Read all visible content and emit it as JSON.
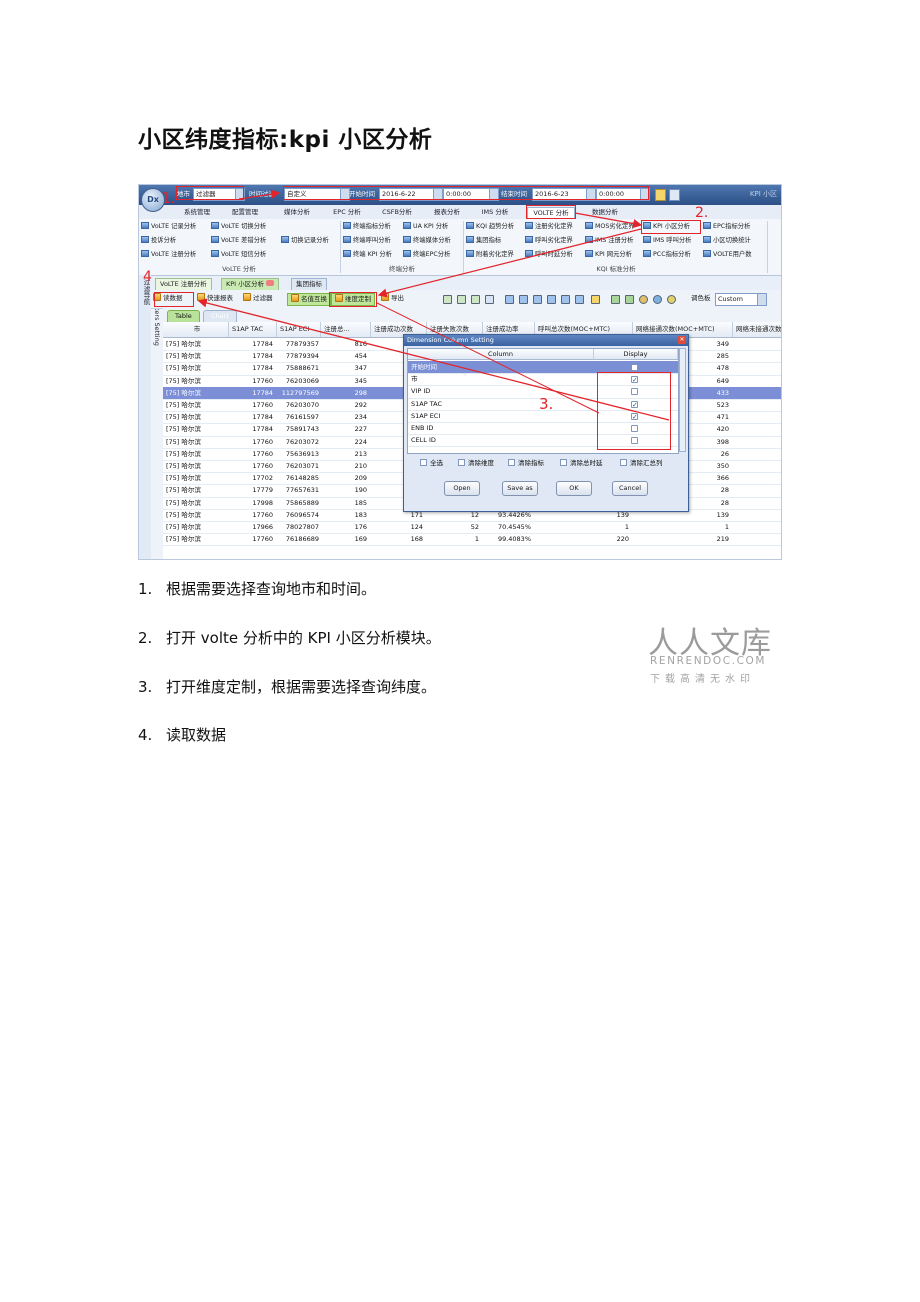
{
  "document": {
    "title": "小区纬度指标:kpi 小区分析",
    "steps": [
      {
        "num": "1.",
        "text": "根据需要选择查询地市和时间。"
      },
      {
        "num": "2.",
        "text": "打开 volte 分析中的 KPI 小区分析模块。"
      },
      {
        "num": "3.",
        "text": "打开维度定制，根据需要选择查询纬度。"
      },
      {
        "num": "4.",
        "text": "读取数据"
      }
    ]
  },
  "screenshot": {
    "logo": "Dx",
    "topbar": {
      "city_label": "地市",
      "city_value": "过滤器",
      "time_filter_label": "时间过滤",
      "time_filter_value": "自定义",
      "start_label": "开始时间",
      "start_date": "2016-6-22",
      "start_time": "0:00:00",
      "end_label": "结束时间",
      "end_date": "2016-6-23",
      "end_time": "0:00:00",
      "app_title": "KPI 小区"
    },
    "menu_tabs": [
      "系统管理",
      "配置管理",
      "媒体分析",
      "EPC 分析",
      "CSFB分析",
      "报表分析",
      "IMS 分析",
      "VOLTE 分析",
      "数据分析"
    ],
    "ribbon": {
      "col1": [
        "VoLTE 记录分析",
        "投诉分析",
        "VoLTE 注册分析"
      ],
      "col2": [
        "VoLTE 切换分析",
        "VoLTE 差错分析",
        "VoLTE 短信分析"
      ],
      "col3": [
        "切换记录分析"
      ],
      "col4": [
        "终端指标分析",
        "终端呼叫分析",
        "终端 KPI 分析"
      ],
      "col5": [
        "UA KPI 分析",
        "终端媒体分析",
        "终端EPC分析"
      ],
      "col6": [
        "KQI 趋势分析",
        "集团指标",
        "附着劣化定界"
      ],
      "col7": [
        "注册劣化定界",
        "呼叫劣化定界",
        "呼叫时延分析"
      ],
      "col8": [
        "MOS劣化定界",
        "IMS 注册分析",
        "KPI 网元分析"
      ],
      "col9": [
        "KPI 小区分析",
        "IMS 呼叫分析",
        "PCC指标分析"
      ],
      "col10": [
        "EPC指标分析",
        "小区切换统计",
        "VOLTE用户数"
      ],
      "groups": [
        "VoLTE 分析",
        "终端分析",
        "KQI 标准分析"
      ]
    },
    "left_strip": "过滤导航",
    "filters_strip": "Filters Setting",
    "subtabs": [
      "VoLTE 注册分析",
      "KPI 小区分析",
      "集团指标"
    ],
    "toolbar": {
      "read_data": "读数据",
      "quick_report": "快速报表",
      "filter": "过滤器",
      "name_swap": "名值互换",
      "dimension": "维度定制",
      "export": "导出",
      "palette_label": "调色板",
      "palette_value": "Custom"
    },
    "view_tabs": [
      "Table",
      "Chart"
    ],
    "grid": {
      "headers": [
        "市",
        "S1AP TAC",
        "S1AP ECI",
        "注册总...",
        "注册成功次数",
        "注册失败次数",
        "注册成功率",
        "呼叫总次数(MOC+MTC)",
        "网络接通次数(MOC+MTC)",
        "网络未接通次数"
      ],
      "rows": [
        [
          "[75] 哈尔滨",
          "17784",
          "77879357",
          "816",
          "",
          "",
          "",
          "",
          "349"
        ],
        [
          "[75] 哈尔滨",
          "17784",
          "77879394",
          "454",
          "",
          "",
          "",
          "",
          "285"
        ],
        [
          "[75] 哈尔滨",
          "17784",
          "75888671",
          "347",
          "",
          "",
          "",
          "",
          "478"
        ],
        [
          "[75] 哈尔滨",
          "17760",
          "76203069",
          "345",
          "",
          "",
          "",
          "",
          "649"
        ],
        [
          "[75] 哈尔滨",
          "17784",
          "112797569",
          "298",
          "",
          "",
          "",
          "",
          "433"
        ],
        [
          "[75] 哈尔滨",
          "17760",
          "76203070",
          "292",
          "",
          "",
          "",
          "",
          "523"
        ],
        [
          "[75] 哈尔滨",
          "17784",
          "76161597",
          "234",
          "",
          "",
          "",
          "",
          "471"
        ],
        [
          "[75] 哈尔滨",
          "17784",
          "75891743",
          "227",
          "",
          "",
          "",
          "",
          "420"
        ],
        [
          "[75] 哈尔滨",
          "17760",
          "76203072",
          "224",
          "",
          "",
          "",
          "",
          "398"
        ],
        [
          "[75] 哈尔滨",
          "17760",
          "75636913",
          "213",
          "",
          "",
          "",
          "",
          "26"
        ],
        [
          "[75] 哈尔滨",
          "17760",
          "76203071",
          "210",
          "",
          "",
          "",
          "",
          "350"
        ],
        [
          "[75] 哈尔滨",
          "17702",
          "76148285",
          "209",
          "",
          "",
          "",
          "",
          "366"
        ],
        [
          "[75] 哈尔滨",
          "17779",
          "77657631",
          "190",
          "",
          "",
          "",
          "",
          "28"
        ],
        [
          "[75] 哈尔滨",
          "17998",
          "75865889",
          "185",
          "184",
          "1",
          "99.4595%",
          "28",
          "28"
        ],
        [
          "[75] 哈尔滨",
          "17760",
          "76096574",
          "183",
          "171",
          "12",
          "93.4426%",
          "139",
          "139"
        ],
        [
          "[75] 哈尔滨",
          "17966",
          "78027807",
          "176",
          "124",
          "52",
          "70.4545%",
          "1",
          "1"
        ],
        [
          "[75] 哈尔滨",
          "17760",
          "76186689",
          "169",
          "168",
          "1",
          "99.4083%",
          "220",
          "219"
        ]
      ]
    },
    "dialog": {
      "title": "Dimension Column Setting",
      "col_header": "Column",
      "display_header": "Display",
      "rows": [
        {
          "name": "开始时间",
          "checked": false
        },
        {
          "name": "市",
          "checked": true
        },
        {
          "name": "VIP ID",
          "checked": false
        },
        {
          "name": "S1AP TAC",
          "checked": true
        },
        {
          "name": "S1AP ECI",
          "checked": true
        },
        {
          "name": "ENB ID",
          "checked": false
        },
        {
          "name": "CELL ID",
          "checked": false
        }
      ],
      "options": [
        "全选",
        "清除维度",
        "清除指标",
        "清除总时延",
        "清除汇总列"
      ],
      "buttons": [
        "Open",
        "Save as",
        "OK",
        "Cancel"
      ]
    },
    "annotations": [
      "1.",
      "2.",
      "3.",
      "4"
    ]
  },
  "watermark": {
    "cn": "人人文库",
    "en": "RENRENDOC.COM",
    "sub": "下载高清无水印"
  },
  "colors": {
    "annotation_red": "#e3242b",
    "selection_blue": "#7c8fd6",
    "header_blue": "#2c4f86"
  }
}
